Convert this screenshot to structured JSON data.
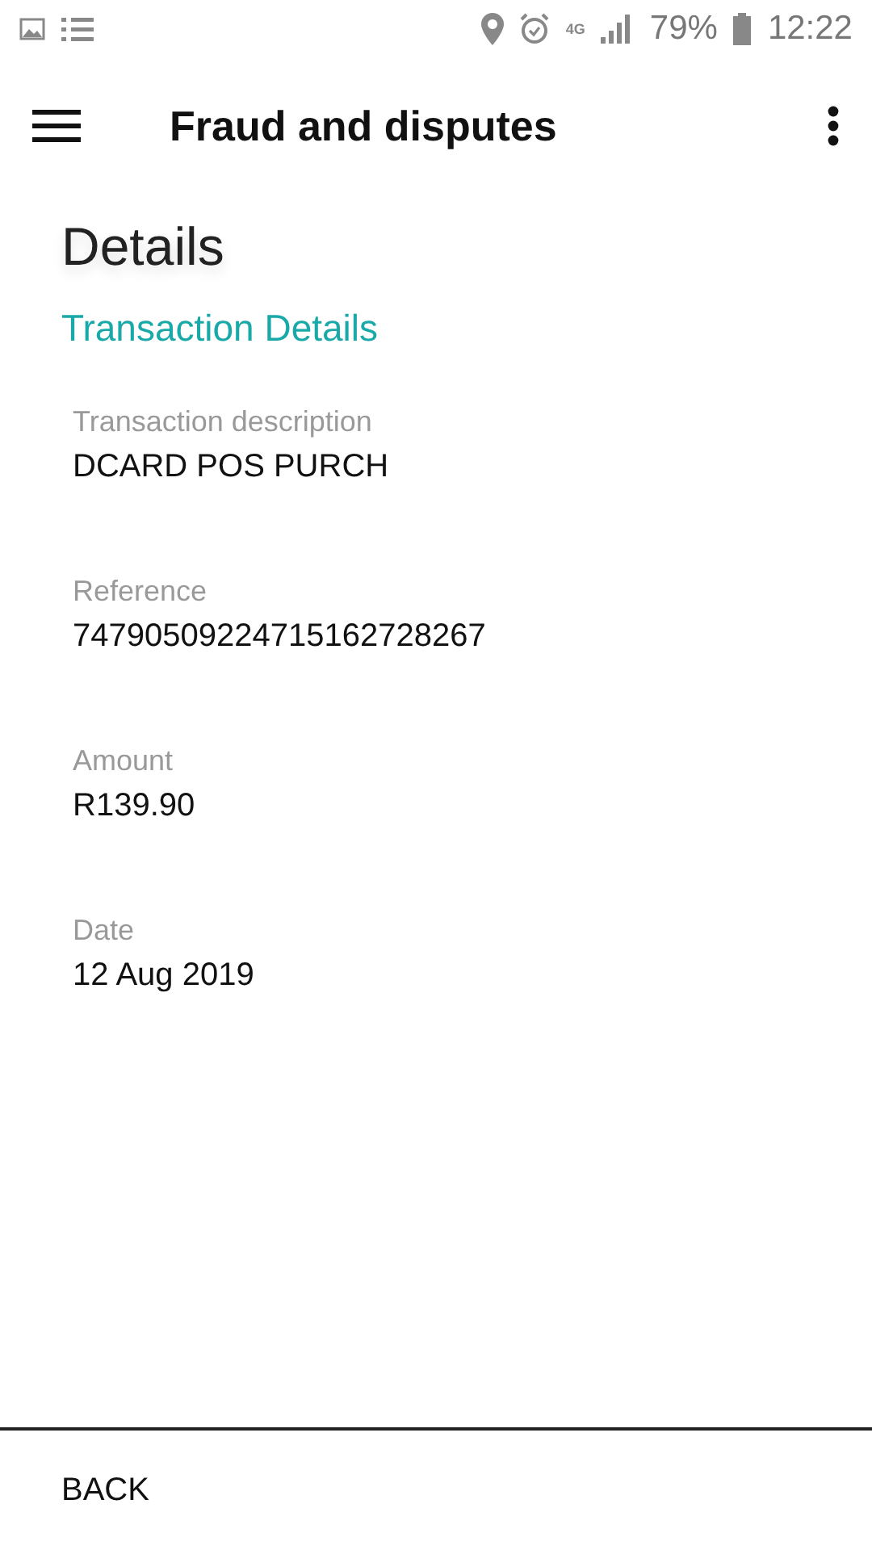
{
  "status_bar": {
    "network": "4G",
    "battery": "79%",
    "time": "12:22"
  },
  "app_bar": {
    "title": "Fraud and disputes"
  },
  "heading": "Details",
  "section_title": "Transaction Details",
  "fields": [
    {
      "label": "Transaction description",
      "value": "DCARD POS PURCH"
    },
    {
      "label": "Reference",
      "value": "74790509224715162728267"
    },
    {
      "label": "Amount",
      "value": "R139.90"
    },
    {
      "label": "Date",
      "value": "12 Aug 2019"
    }
  ],
  "footer": {
    "back_button": "BACK"
  }
}
